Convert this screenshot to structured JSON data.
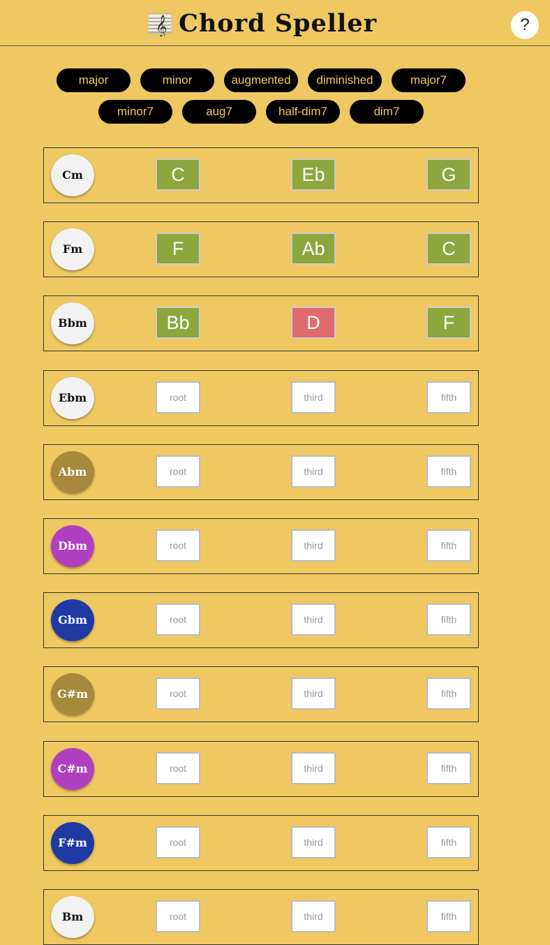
{
  "header": {
    "title": "Chord Speller",
    "logo_icon": "treble-clef-staff-icon",
    "help_label": "?"
  },
  "chord_types": {
    "row1": [
      "major",
      "minor",
      "augmented",
      "diminished",
      "major7"
    ],
    "row2": [
      "minor7",
      "aug7",
      "half-dim7",
      "dim7"
    ]
  },
  "placeholders": {
    "root": "root",
    "third": "third",
    "fifth": "fifth"
  },
  "colors": {
    "background": "#efc862",
    "pill": "#000000",
    "pill_text": "#efc862",
    "correct": "#8ea63e",
    "wrong": "#e06b6e",
    "badge_white": "#f2f2f2",
    "badge_gold": "#a8883a",
    "badge_purple": "#b040c0",
    "badge_blue": "#1f3ba3"
  },
  "chords": [
    {
      "name": "Cm",
      "badge": "white",
      "root": "C",
      "third": "Eb",
      "fifth": "G",
      "root_state": "correct",
      "third_state": "correct",
      "fifth_state": "correct"
    },
    {
      "name": "Fm",
      "badge": "white",
      "root": "F",
      "third": "Ab",
      "fifth": "C",
      "root_state": "correct",
      "third_state": "correct",
      "fifth_state": "correct"
    },
    {
      "name": "Bbm",
      "badge": "white",
      "root": "Bb",
      "third": "D",
      "fifth": "F",
      "root_state": "correct",
      "third_state": "wrong",
      "fifth_state": "correct"
    },
    {
      "name": "Ebm",
      "badge": "white",
      "root": "",
      "third": "",
      "fifth": ""
    },
    {
      "name": "Abm",
      "badge": "gold",
      "root": "",
      "third": "",
      "fifth": ""
    },
    {
      "name": "Dbm",
      "badge": "purple",
      "root": "",
      "third": "",
      "fifth": ""
    },
    {
      "name": "Gbm",
      "badge": "blue",
      "root": "",
      "third": "",
      "fifth": ""
    },
    {
      "name": "G#m",
      "badge": "gold",
      "root": "",
      "third": "",
      "fifth": ""
    },
    {
      "name": "C#m",
      "badge": "purple",
      "root": "",
      "third": "",
      "fifth": ""
    },
    {
      "name": "F#m",
      "badge": "blue",
      "root": "",
      "third": "",
      "fifth": ""
    },
    {
      "name": "Bm",
      "badge": "white",
      "root": "",
      "third": "",
      "fifth": ""
    }
  ]
}
